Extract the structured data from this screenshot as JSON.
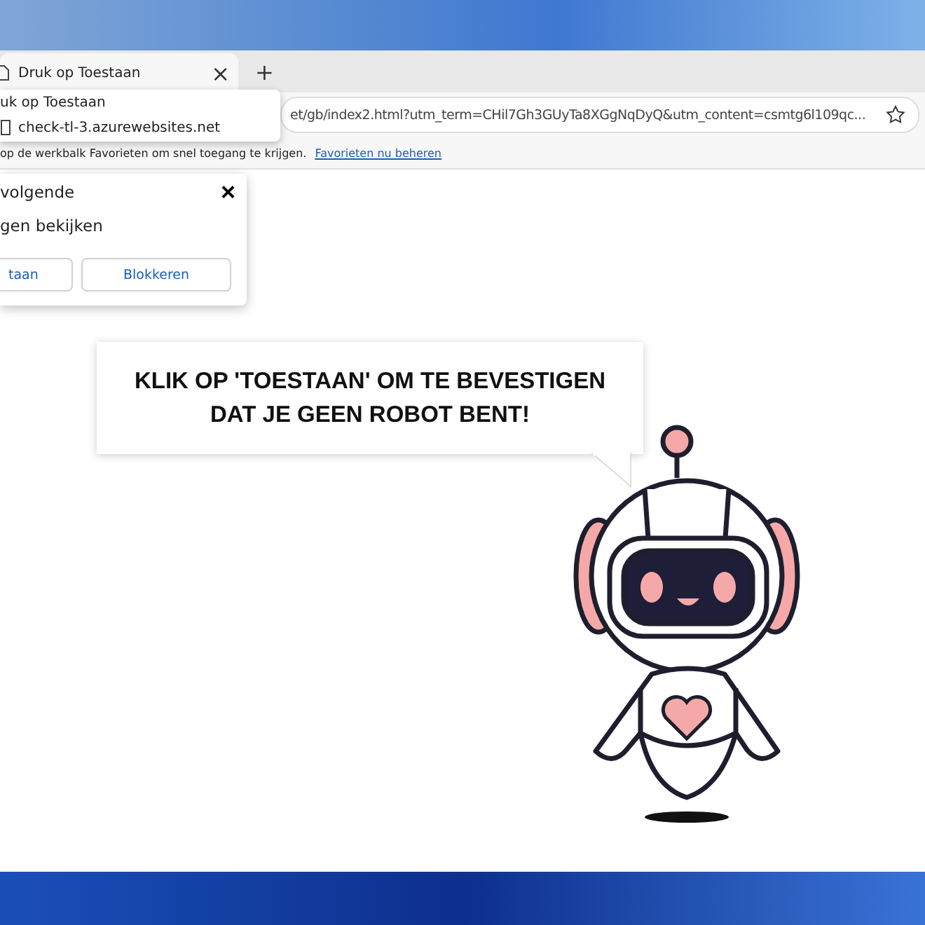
{
  "tab": {
    "title": "Druk op Toestaan",
    "close": "×",
    "new_tab": "+"
  },
  "tab_tooltip": {
    "title": "uk op Toestaan",
    "host": "check-tl-3.azurewebsites.net"
  },
  "address_bar": {
    "url": "et/gb/index2.html?utm_term=CHil7Gh3GUyTa8XGgNqDyQ&utm_content=csmtg6l109qc..."
  },
  "favorites_bar": {
    "text": "op de werkbalk Favorieten om snel toegang te krijgen.",
    "link": "Favorieten nu beheren"
  },
  "permission_popup": {
    "title": "volgende",
    "body": "gen bekijken",
    "close": "×",
    "buttons": [
      "taan",
      "Blokkeren"
    ]
  },
  "speech_bubble": {
    "lines": [
      "KLIK OP 'TOESTAAN' OM TE BEVESTIGEN",
      "DAT JE GEEN ROBOT BENT!"
    ]
  }
}
